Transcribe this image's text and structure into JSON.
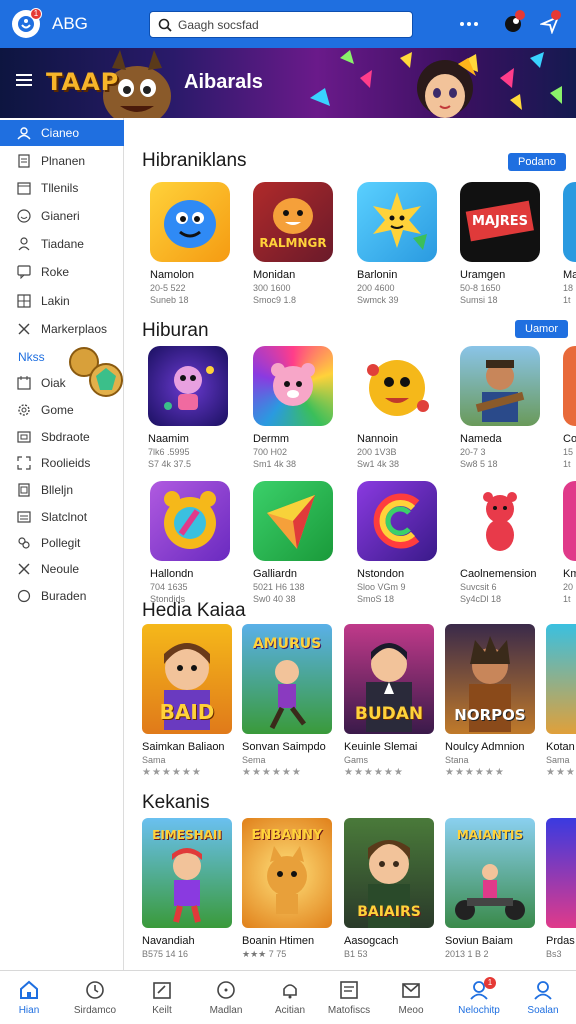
{
  "header": {
    "app_title": "ABG",
    "badge": "1",
    "search_placeholder": "Gaagh socsfad"
  },
  "banner": {
    "brand": "TAAP",
    "title": "Aibarals"
  },
  "sidebar": {
    "items": [
      {
        "label": "Cianeo",
        "icon": "user-icon",
        "active": true
      },
      {
        "label": "Plnanen",
        "icon": "doc-icon"
      },
      {
        "label": "Tllenils",
        "icon": "calendar-icon"
      },
      {
        "label": "Gianeri",
        "icon": "smile-icon"
      },
      {
        "label": "Tiadane",
        "icon": "person-icon"
      },
      {
        "label": "Roke",
        "icon": "chat-icon"
      },
      {
        "label": "Lakin",
        "icon": "grid-icon"
      },
      {
        "label": "Markerplaos",
        "icon": "tools-icon"
      }
    ],
    "section": "Nkss",
    "items2": [
      {
        "label": "Oiak",
        "icon": "calendar-icon"
      },
      {
        "label": "Gome",
        "icon": "gear-icon"
      },
      {
        "label": "Sbdraote",
        "icon": "image-icon"
      },
      {
        "label": "Roolieids",
        "icon": "expand-icon"
      },
      {
        "label": "Blleljn",
        "icon": "file-icon"
      },
      {
        "label": "Slatclnot",
        "icon": "list-icon"
      },
      {
        "label": "Pollegit",
        "icon": "puzzle-icon"
      },
      {
        "label": "Neoule",
        "icon": "close-icon"
      },
      {
        "label": "Buraden",
        "icon": "circle-icon"
      }
    ]
  },
  "sections": [
    {
      "title": "Hibraniklans",
      "more": "Podano",
      "cards": [
        {
          "name": "Namolon",
          "meta1": "20-5 522",
          "meta2": "Suneb 18"
        },
        {
          "name": "Monidan",
          "meta1": "300 1600",
          "meta2": "Smoc9 1.8",
          "art": "RALMNGR"
        },
        {
          "name": "Barlonin",
          "meta1": "200 4600",
          "meta2": "Swmck 39"
        },
        {
          "name": "Uramgen",
          "meta1": "50-8 1650",
          "meta2": "Sumsi 18",
          "art": "MAJRES"
        },
        {
          "name": "Ma",
          "meta1": "18",
          "meta2": "1t"
        }
      ]
    },
    {
      "title": "Hiburan",
      "more": "Uamor",
      "cards": [
        {
          "name": "Naamim",
          "meta1": "7lk6 .5995",
          "meta2": "S7 4k 37.5"
        },
        {
          "name": "Dermm",
          "meta1": "700 H02",
          "meta2": "Sm1 4k 38"
        },
        {
          "name": "Nannoin",
          "meta1": "200 1V3B",
          "meta2": "Sw1 4k 38"
        },
        {
          "name": "Nameda",
          "meta1": "20-7 3",
          "meta2": "Sw8 5 18"
        },
        {
          "name": "Co",
          "meta1": "15",
          "meta2": "1t"
        }
      ]
    },
    {
      "title": "",
      "more": "",
      "cards": [
        {
          "name": "Hallondn",
          "meta1": "704 1635",
          "meta2": "Stondids"
        },
        {
          "name": "Galliardn",
          "meta1": "5021 H6 138",
          "meta2": "Sw0 40 38"
        },
        {
          "name": "Nstondon",
          "meta1": "Sloo VGm 9",
          "meta2": "SmoS 18"
        },
        {
          "name": "Caolnemension",
          "meta1": "Suvcsit 6",
          "meta2": "Sy4cDl 18"
        },
        {
          "name": "Km",
          "meta1": "20",
          "meta2": "1t"
        }
      ]
    },
    {
      "title": "Hedia Kaiaa",
      "more": "",
      "cards": [
        {
          "name": "Saimkan Baliaon",
          "meta1": "Sama",
          "stars": "★★★★★★",
          "art": "BAID"
        },
        {
          "name": "Sonvan Saimpdo",
          "meta1": "Sema",
          "stars": "★★★★★★",
          "art": "AMURUS"
        },
        {
          "name": "Keuinle Slemai",
          "meta1": "Gams",
          "stars": "★★★★★★",
          "art": "BUDAN"
        },
        {
          "name": "Noulcy Admnion",
          "meta1": "Stana",
          "stars": "★★★★★★",
          "art": "NORPOS"
        },
        {
          "name": "Kotan",
          "meta1": "Sama",
          "stars": "★★★"
        }
      ]
    },
    {
      "title": "Kekanis",
      "more": "",
      "cards": [
        {
          "name": "Navandiah",
          "meta1": "B575 14 16",
          "art": "EIMESHAII"
        },
        {
          "name": "Boanin Htimen",
          "meta1": "★★★ 7 75",
          "art": "ENBANNY"
        },
        {
          "name": "Aasogcach",
          "meta1": "B1 53",
          "art": "BAIAIRS"
        },
        {
          "name": "Soviun Baiam",
          "meta1": "2013 1 B 2",
          "art": "MAIANTIS"
        },
        {
          "name": "Prdas",
          "meta1": "Bs3"
        }
      ]
    }
  ],
  "bottom_nav": [
    {
      "label": "Hian",
      "icon": "home-icon",
      "active": true
    },
    {
      "label": "Sirdamco",
      "icon": "clock-icon"
    },
    {
      "label": "Keilt",
      "icon": "edit-icon"
    },
    {
      "label": "Madlan",
      "icon": "circle-icon"
    },
    {
      "label": "Acitian",
      "icon": "bell-icon"
    },
    {
      "label": "Matofiscs",
      "icon": "doc-icon"
    },
    {
      "label": "Meoo",
      "icon": "mail-icon"
    },
    {
      "label": "Nelochitp",
      "icon": "profile-badge-icon",
      "badge": "1"
    },
    {
      "label": "Soalan",
      "icon": "profile-icon"
    }
  ],
  "colors": {
    "primary": "#1f6fe0",
    "banner_dark": "#1a1a55",
    "badge": "#e53935"
  }
}
